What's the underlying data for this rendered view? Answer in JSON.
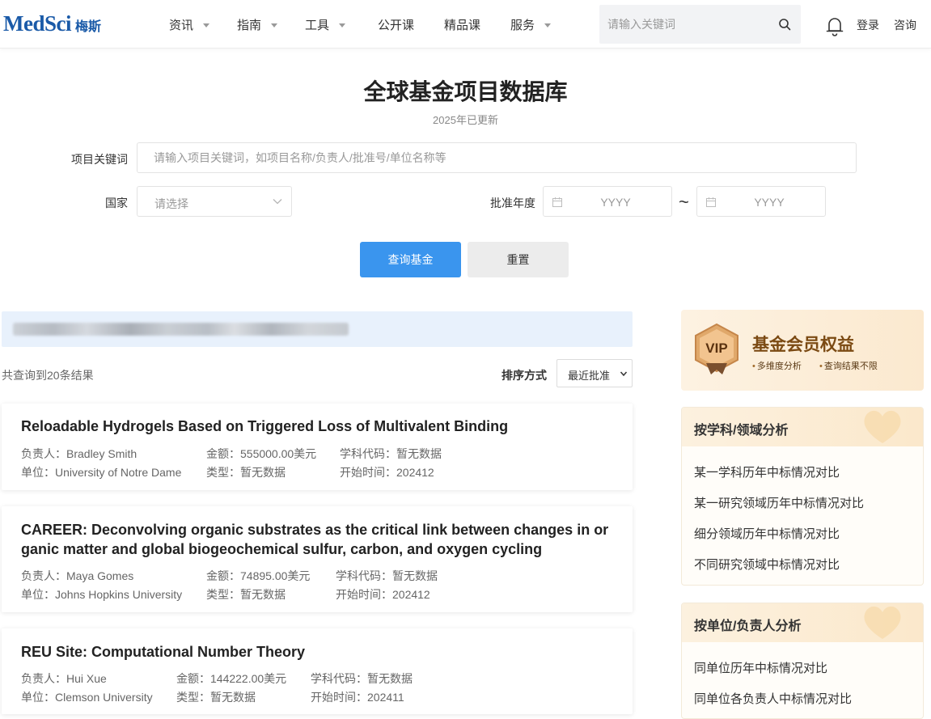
{
  "header": {
    "logo": "MedSci",
    "logo_cn": "梅斯",
    "nav": [
      {
        "label": "资讯",
        "dropdown": true
      },
      {
        "label": "指南",
        "dropdown": true
      },
      {
        "label": "工具",
        "dropdown": true
      },
      {
        "label": "公开课",
        "dropdown": false
      },
      {
        "label": "精品课",
        "dropdown": false
      },
      {
        "label": "服务",
        "dropdown": true
      }
    ],
    "search_placeholder": "请输入关键词",
    "login": "登录",
    "consult": "咨询"
  },
  "hero": {
    "title": "全球基金项目数据库",
    "subtitle": "2025年已更新"
  },
  "form": {
    "keyword_label": "项目关键词",
    "keyword_placeholder": "请输入项目关键词，如项目名称/负责人/批准号/单位名称等",
    "country_label": "国家",
    "country_placeholder": "请选择",
    "year_label": "批准年度",
    "year_from_placeholder": "YYYY",
    "year_to_placeholder": "YYYY",
    "range_sep": "~",
    "submit": "查询基金",
    "reset": "重置"
  },
  "results": {
    "count_text": "共查询到20条结果",
    "sort_label": "排序方式",
    "sort_value": "最近批准",
    "labels": {
      "leader": "负责人：",
      "amount": "金额：",
      "subject": "学科代码：",
      "unit": "单位：",
      "type": "类型：",
      "start": "开始时间："
    },
    "items": [
      {
        "title": "Reloadable Hydrogels Based on Triggered Loss of Multivalent Binding",
        "leader": "Bradley Smith",
        "amount": "555000.00美元",
        "subject": "暂无数据",
        "unit": "University of Notre Dame",
        "type": "暂无数据",
        "start": "202412"
      },
      {
        "title_line1": "CAREER: Deconvolving organic substrates as the critical link between changes in or",
        "title_line2": "ganic matter and global biogeochemical sulfur, carbon, and oxygen cycling",
        "leader": "Maya Gomes",
        "amount": "74895.00美元",
        "subject": "暂无数据",
        "unit": "Johns Hopkins University",
        "type": "暂无数据",
        "start": "202412"
      },
      {
        "title": "REU Site: Computational Number Theory",
        "leader": "Hui Xue",
        "amount": "144222.00美元",
        "subject": "暂无数据",
        "unit": "Clemson University",
        "type": "暂无数据",
        "start": "202411"
      }
    ]
  },
  "sidebar": {
    "vip": {
      "badge": "VIP",
      "title": "基金会员权益",
      "features": [
        "多维度分析",
        "查询结果不限"
      ]
    },
    "subject_panel": {
      "title": "按学科/领域分析",
      "links": [
        "某一学科历年中标情况对比",
        "某一研究领域历年中标情况对比",
        "细分领域历年中标情况对比",
        "不同研究领域中标情况对比"
      ]
    },
    "unit_panel": {
      "title": "按单位/负责人分析",
      "links": [
        "同单位历年中标情况对比",
        "同单位各负责人中标情况对比"
      ]
    }
  },
  "colors": {
    "brand": "#1a5aa8",
    "primary_button": "#3a95ee",
    "banner_bg": "#e8f1fc",
    "vip_text": "#7b4a13"
  }
}
